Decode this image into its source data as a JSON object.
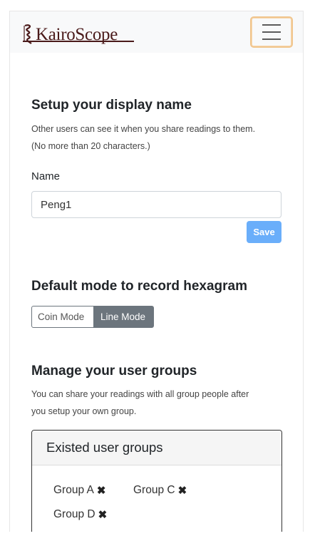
{
  "navbar": {
    "brand": "KairoScope",
    "menu_icon": "hamburger-icon"
  },
  "display_name": {
    "title": "Setup your display name",
    "desc_line1": "Other users can see it when you share readings to them.",
    "desc_line2": "(No more than 20 characters.)",
    "label": "Name",
    "value": "Peng1",
    "save_label": "Save"
  },
  "hexagram_mode": {
    "title": "Default mode to record hexagram",
    "options": [
      "Coin Mode",
      "Line Mode"
    ],
    "selected": "Line Mode"
  },
  "user_groups": {
    "title": "Manage your user groups",
    "desc_line1": "You can share your readings with all group people after",
    "desc_line2": "you setup your own group.",
    "card_title": "Existed user groups",
    "groups": [
      "Group A",
      "Group C",
      "Group D"
    ],
    "remove_icon": "✖"
  },
  "colors": {
    "save_button": "#6aaefa",
    "selected_mode": "#6c757d",
    "menu_focus": "#f0c58d",
    "brand": "#4a1a1a"
  }
}
